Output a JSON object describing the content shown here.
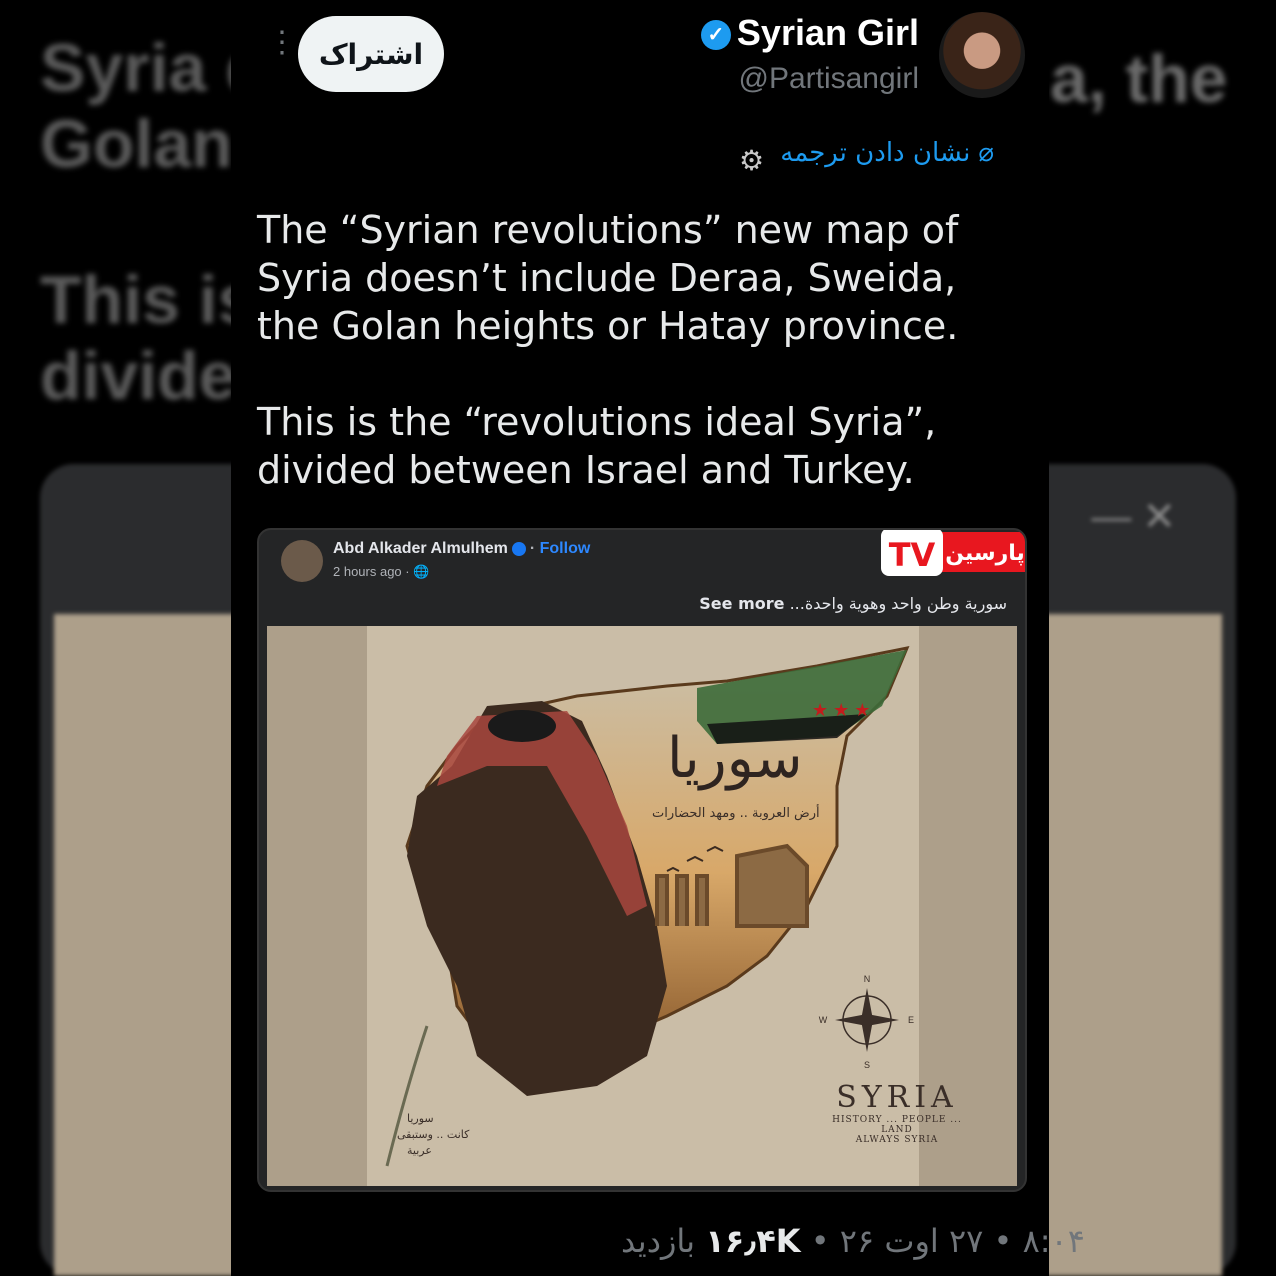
{
  "tweet": {
    "display_name": "Syrian Girl",
    "handle": "@Partisangirl",
    "share_label": "اشتراک",
    "translate_label": "نشان دادن ترجمه",
    "paragraph_1": "The “Syrian revolutions” new map of Syria doesn’t include Deraa, Sweida, the Golan heights or Hatay province.",
    "paragraph_2": "This is the “revolutions ideal Syria”, divided between Israel and Turkey.",
    "time": "۸:۰۴",
    "date": "۲۷ اوت ۲۶",
    "views_count": "۱۶٫۴K",
    "views_label": "بازدید"
  },
  "embedded_post": {
    "author": "Abd Alkader Almulhem",
    "follow_label": "Follow",
    "timestamp": "2 hours ago",
    "caption": "سورية وطن واحد وهوية واحدة...",
    "see_more": "See more"
  },
  "poster": {
    "arabic_title": "سوريا",
    "arabic_subtitle": "أرض العروبة .. ومهد الحضارات",
    "title": "SYRIA",
    "tagline_1": "HISTORY ... PEOPLE ... LAND",
    "tagline_2": "ALWAYS SYRIA",
    "compass_n": "N",
    "compass_s": "S",
    "compass_e": "E",
    "compass_w": "W"
  },
  "watermark": {
    "text": "پارسین",
    "logo_letters": "TV"
  },
  "colors": {
    "accent_blue": "#1d9bf0",
    "background": "#000000",
    "text_primary": "#e7e9ea",
    "text_secondary": "#71767b"
  }
}
